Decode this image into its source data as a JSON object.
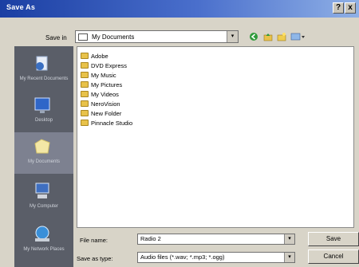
{
  "window": {
    "title": "Save As",
    "help_glyph": "?",
    "close_glyph": "x"
  },
  "look_in": {
    "label": "Save in",
    "value": "My Documents",
    "drop_glyph": "▾"
  },
  "toolbar": {
    "icons": [
      "back-icon",
      "up-folder-icon",
      "new-folder-icon",
      "view-menu-icon"
    ]
  },
  "places": [
    {
      "name": "my-recent-documents",
      "label": "My Recent Documents",
      "icon": "recent-docs-icon"
    },
    {
      "name": "desktop",
      "label": "Desktop",
      "icon": "desktop-icon"
    },
    {
      "name": "my-documents",
      "label": "My Documents",
      "icon": "my-documents-icon"
    },
    {
      "name": "my-computer",
      "label": "My Computer",
      "icon": "computer-icon"
    },
    {
      "name": "my-network-places",
      "label": "My Network Places",
      "icon": "network-icon"
    }
  ],
  "files": [
    "Adobe",
    "DVD Express",
    "My Music",
    "My Pictures",
    "My Videos",
    "NeroVision",
    "New Folder",
    "Pinnacle Studio"
  ],
  "file_name": {
    "label": "File name:",
    "value": "Radio 2",
    "drop_glyph": "▾"
  },
  "save_as_type": {
    "label": "Save as type:",
    "value": "Audio files (*.wav; *.mp3; *.ogg)",
    "drop_glyph": "▾"
  },
  "buttons": {
    "save": "Save",
    "cancel": "Cancel"
  },
  "colors": {
    "title_bar": "#1b3fa3",
    "places_bar": "#5a5e68",
    "folder": "#e8c24a"
  }
}
